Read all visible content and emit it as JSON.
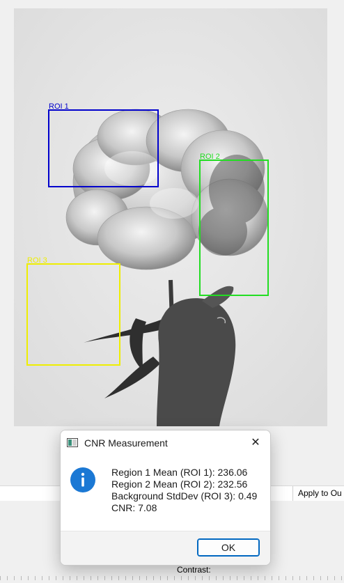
{
  "image_panel": {
    "rois": [
      {
        "label": "ROI 1",
        "color": "#0000cc"
      },
      {
        "label": "ROI 2",
        "color": "#22dd22"
      },
      {
        "label": "ROI 3",
        "color": "#eeee00"
      }
    ]
  },
  "toolbar": {
    "apply_label": "Apply to Ou"
  },
  "bottom_panel": {
    "contrast_label": "Contrast:"
  },
  "dialog": {
    "title": "CNR Measurement",
    "close_glyph": "✕",
    "icon": "info-icon",
    "lines": [
      "Region 1 Mean (ROI 1): 236.06",
      "Region 2 Mean (ROI 2): 232.56",
      "Background StdDev (ROI 3): 0.49",
      "CNR: 7.08"
    ],
    "ok_label": "OK"
  }
}
